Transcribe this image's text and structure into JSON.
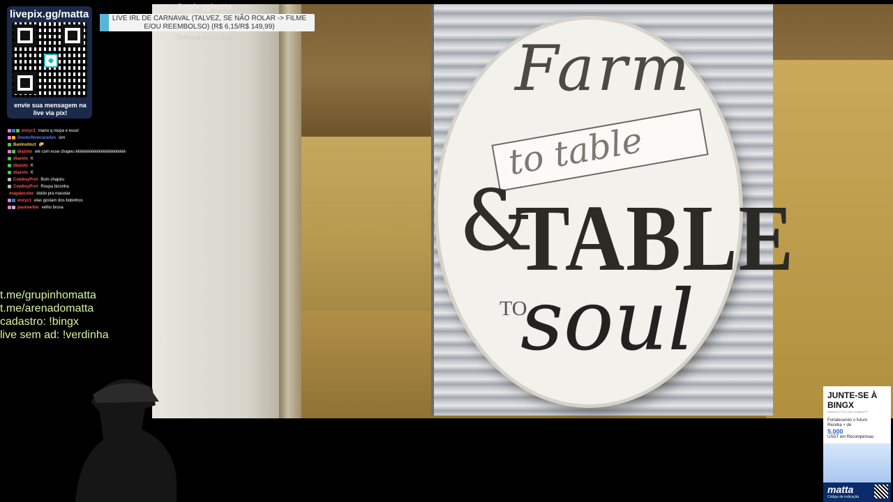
{
  "livepix": {
    "title": "livepix.gg/matta",
    "caption": "envie sua mensagem na live via pix!"
  },
  "goal": {
    "source": "livepix.gg/matta",
    "text": "LIVE IRL DE CARNAVAL (TALVEZ, SE NÃO ROLAR -> FILME E/OU REEMBOLSO) (R$ 6,15/R$ 149,99)",
    "progress": 0.041,
    "ends": "Termina em 2 dias",
    "fill_color": "#5ab4d8"
  },
  "sign": {
    "line1": "Farm",
    "line2": "to table",
    "line3": "&",
    "line4": "TABLE",
    "line5": "TO",
    "line6": "soul"
  },
  "chat": [
    {
      "user": "enzyc1",
      "user_color": "#ff5555",
      "msg": "mano q roupa e essa!",
      "badges": [
        "#e67ad8",
        "#2a7bd4",
        "#51c24b"
      ]
    },
    {
      "user": "DoutorNowzaradan",
      "user_color": "#5b7cff",
      "msg": "sim",
      "badges": [
        "#e67ad8",
        "#ffb400"
      ]
    },
    {
      "user": "Banlnstinct",
      "user_color": "#ffd24a",
      "msg": "🌮",
      "badges": [
        "#51c24b"
      ]
    },
    {
      "user": "diazoto",
      "user_color": "#ff5555",
      "msg": "ele com esse chapeu kkkkkkkkkkkkkkkkkkkkkkkk",
      "badges": [
        "#e67ad8",
        "#51c24b"
      ]
    },
    {
      "user": "diazoto",
      "user_color": "#ff5555",
      "msg": "K",
      "badges": [
        "#51c24b"
      ]
    },
    {
      "user": "diazoto",
      "user_color": "#ff5555",
      "msg": "K",
      "badges": [
        "#51c24b"
      ]
    },
    {
      "user": "diazoto",
      "user_color": "#ff5555",
      "msg": "K",
      "badges": [
        "#51c24b"
      ]
    },
    {
      "user": "CowboyProt",
      "user_color": "#ff5555",
      "msg": "Bom chapéu",
      "badges": [
        "#bbbbbb"
      ]
    },
    {
      "user": "CowboyProt",
      "user_color": "#ff5555",
      "msg": "Roupa bizonha",
      "badges": [
        "#bbbbbb"
      ]
    },
    {
      "user": "magalecolor",
      "user_color": "#ff5555",
      "msg": "doido pra macetar",
      "badges": []
    },
    {
      "user": "enzyc1",
      "user_color": "#ff5555",
      "msg": "elas gostam dos bobinhos",
      "badges": [
        "#e67ad8",
        "#2a7bd4"
      ]
    },
    {
      "user": "pauloarbio",
      "user_color": "#ff5555",
      "msg": "velho brosa",
      "badges": [
        "#e67ad8",
        "#bbbbbb"
      ]
    }
  ],
  "links": [
    "t.me/grupinhomatta",
    "t.me/arenadomatta",
    "cadastro: !bingx",
    "live sem ad: !verdinha"
  ],
  "ad": {
    "title": "JUNTE-SE À BINGX",
    "note": "Sponsor. FTVG.com Chapeau™",
    "line1": "Fortalecendo o futuro",
    "line2": "Receba + de",
    "amount": "5.000",
    "currency": "USDT",
    "line3": "em Recompensas",
    "brand": "matta",
    "code_label": "Código de indicação"
  }
}
